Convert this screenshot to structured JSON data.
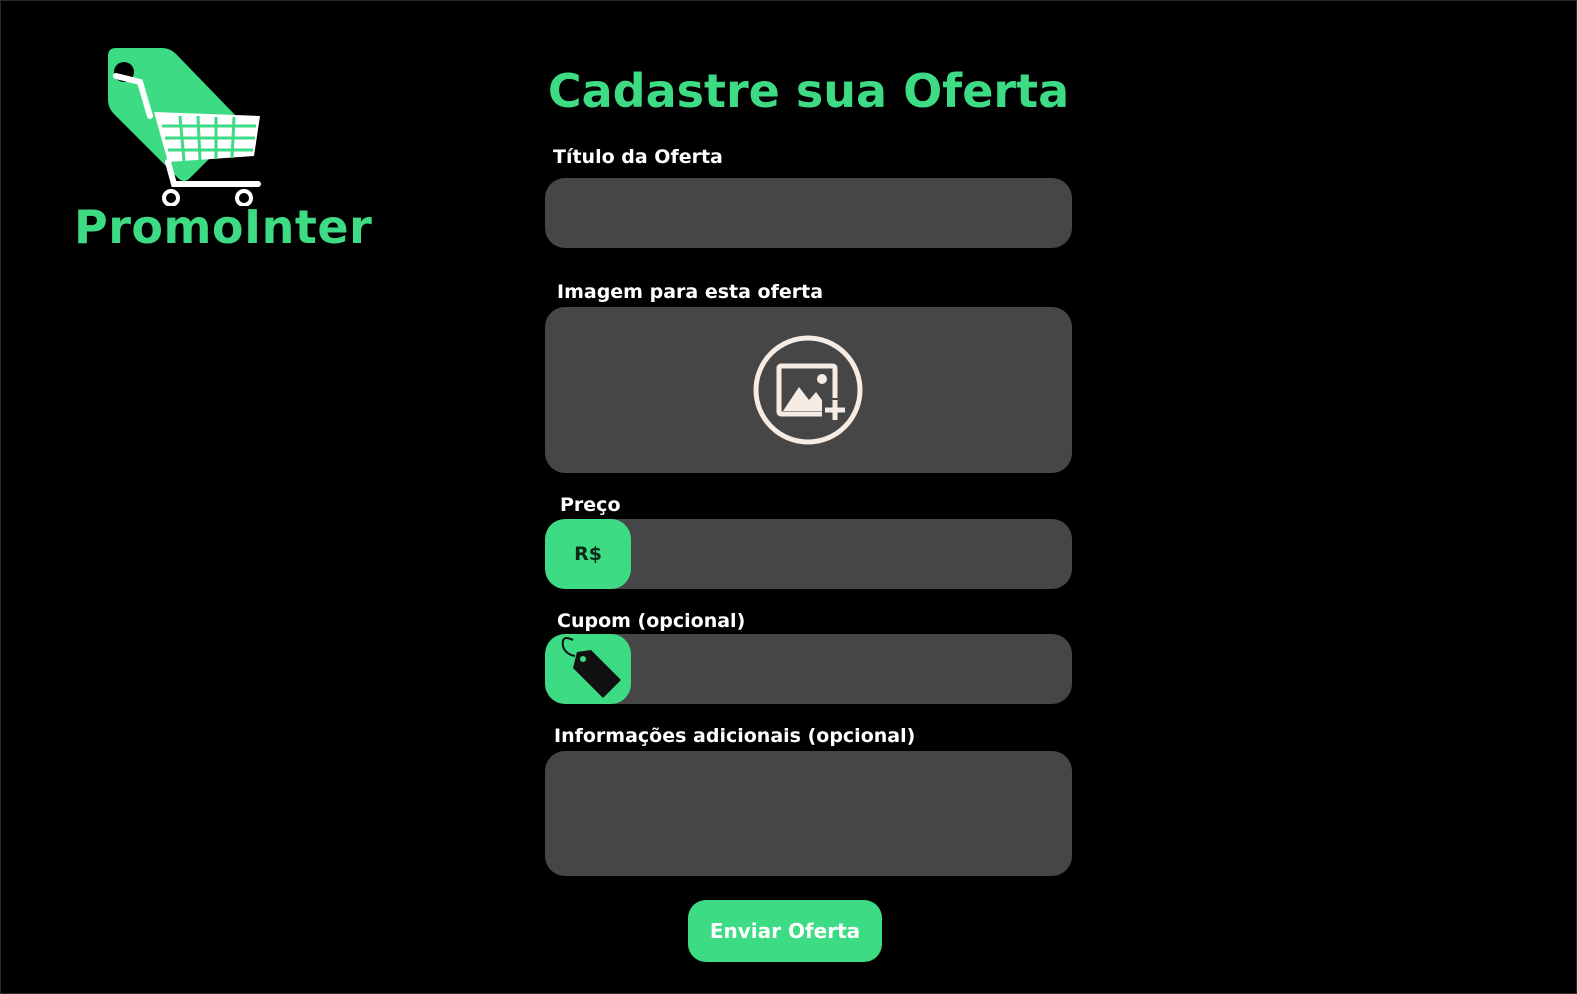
{
  "brand": {
    "name": "PromoInter",
    "color": "#3ddc84",
    "logo_icon": "shopping-cart-tag-icon"
  },
  "form": {
    "title": "Cadastre sua Oferta",
    "fields": {
      "titulo": {
        "label": "Título da Oferta",
        "value": "",
        "placeholder": ""
      },
      "imagem": {
        "label": "Imagem para esta oferta",
        "icon": "add-image-icon"
      },
      "preco": {
        "label": "Preço",
        "prefix": "R$",
        "value": "",
        "placeholder": ""
      },
      "cupom": {
        "label": "Cupom (opcional)",
        "icon": "tag-icon",
        "value": "",
        "placeholder": ""
      },
      "info": {
        "label": "Informações adicionais (opcional)",
        "value": "",
        "placeholder": ""
      }
    },
    "submit_label": "Enviar Oferta"
  },
  "colors": {
    "background": "#000000",
    "accent": "#3ddc84",
    "field_background": "#464646",
    "label_text": "#ffffff"
  }
}
